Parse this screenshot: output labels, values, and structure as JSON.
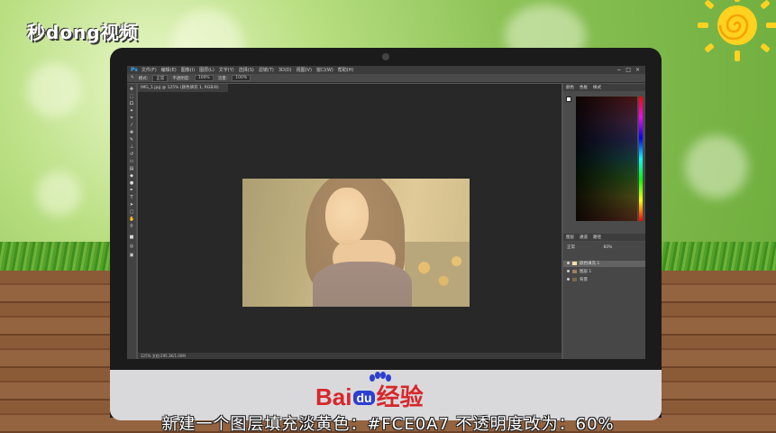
{
  "watermark": {
    "logo_text": "秒dong视频"
  },
  "monitor_brand": {
    "bai": "Bai",
    "du": "du",
    "jingyan": "经验"
  },
  "photoshop": {
    "menu": [
      "文件(F)",
      "编辑(E)",
      "图像(I)",
      "图层(L)",
      "文字(Y)",
      "选择(S)",
      "滤镜(T)",
      "3D(D)",
      "视图(V)",
      "窗口(W)",
      "帮助(H)"
    ],
    "window_controls": [
      "−",
      "□",
      "×"
    ],
    "options_bar": {
      "mode_label": "模式:",
      "mode_value": "正常",
      "opacity_label": "不透明度:",
      "opacity_value": "100%",
      "flow_label": "流量:",
      "flow_value": "100%"
    },
    "doc_tab": "IMG_1.jpg @ 125% (颜色填充 1, RGB/8)",
    "status": "125%   文档:295.3K/1.06M",
    "panels": {
      "color_tabs": [
        "颜色",
        "色板",
        "样式"
      ],
      "layer_tabs": [
        "图层",
        "通道",
        "路径"
      ],
      "blend_mode": "正常",
      "opacity": "60%",
      "layers": [
        {
          "name": "颜色填充 1",
          "selected": true,
          "thumb_color": "#FCE0A7"
        },
        {
          "name": "图层 1",
          "selected": false,
          "thumb_color": "#a0805f"
        },
        {
          "name": "背景",
          "selected": false,
          "thumb_color": "#7a6a4a"
        }
      ]
    }
  },
  "caption": "新建一个图层填充淡黄色：#FCE0A7 不透明度改为：60%"
}
